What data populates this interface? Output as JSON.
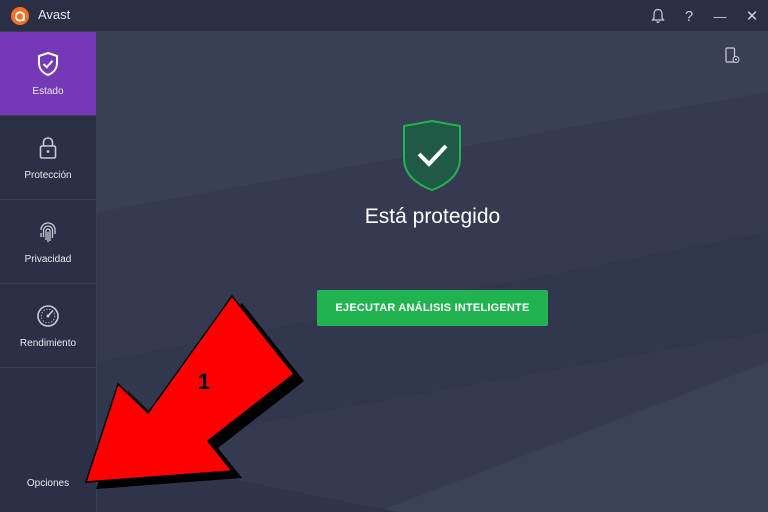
{
  "app": {
    "title": "Avast"
  },
  "titlebar": {
    "icons": [
      "bell-icon",
      "help-icon",
      "minimize-icon",
      "close-icon"
    ],
    "help_glyph": "?",
    "minimize_glyph": "—",
    "close_glyph": "✕"
  },
  "sidebar": {
    "items": [
      {
        "label": "Estado",
        "icon": "shield-check-icon",
        "active": true
      },
      {
        "label": "Protección",
        "icon": "lock-icon",
        "active": false
      },
      {
        "label": "Privacidad",
        "icon": "fingerprint-icon",
        "active": false
      },
      {
        "label": "Rendimiento",
        "icon": "speedometer-icon",
        "active": false
      }
    ],
    "options_label": "Opciones"
  },
  "main": {
    "status": "Está protegido",
    "scan_button": "EJECUTAR ANÁLISIS INTELIGENTE",
    "device_icon": "mobile-device-icon"
  },
  "annotation": {
    "number": "1",
    "arrow_color": "#ff0000"
  },
  "colors": {
    "accent": "#7539b8",
    "success": "#21b34f",
    "brand": "#f36f21"
  }
}
